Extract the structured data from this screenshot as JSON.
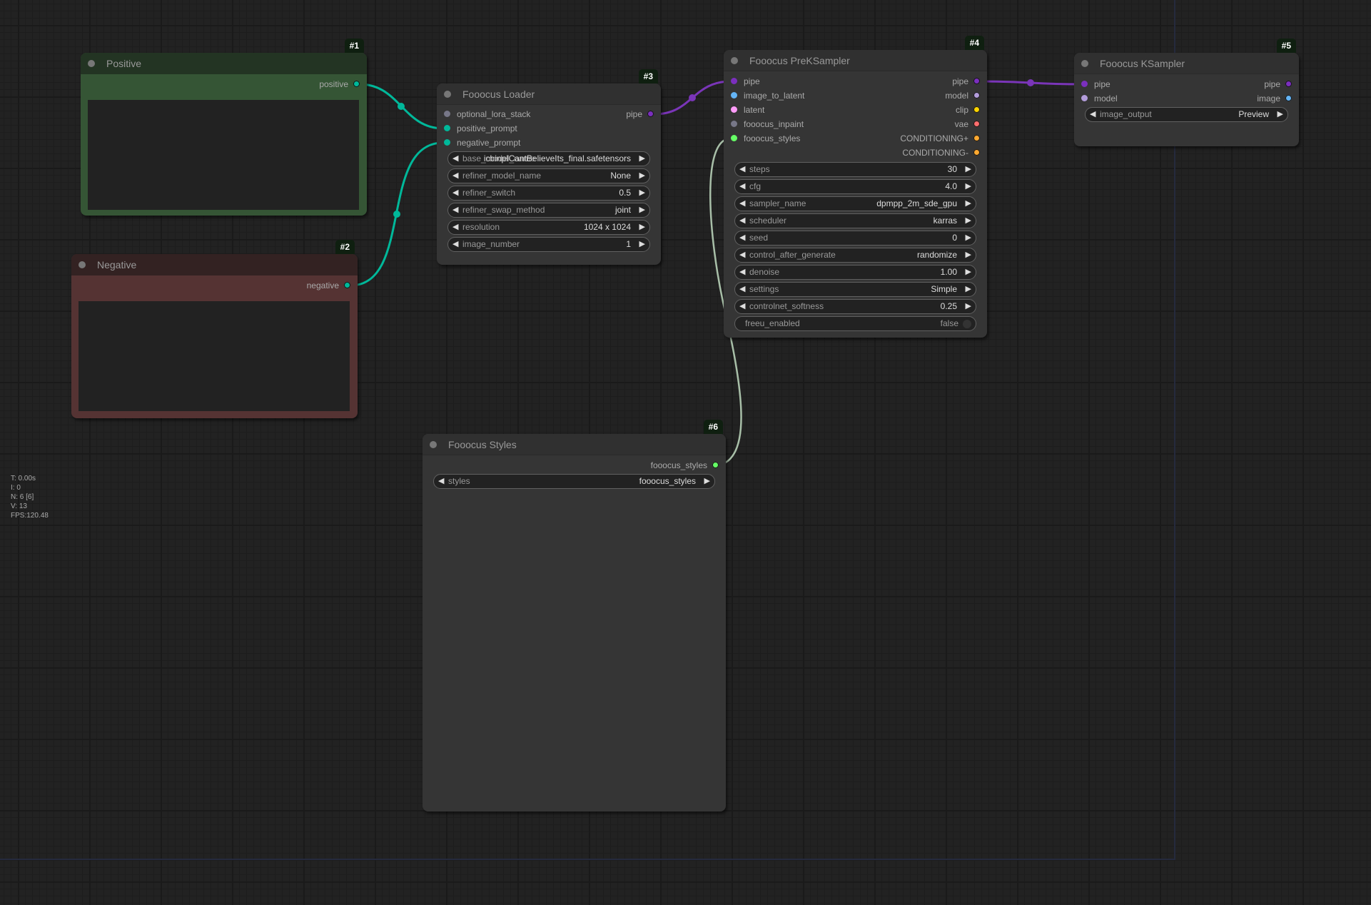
{
  "canvas": {
    "stats": [
      "T: 0.00s",
      "I: 0",
      "N: 6 [6]",
      "V: 13",
      "FPS:120.48"
    ]
  },
  "colors": {
    "canvas_bg": "#222222",
    "node_bg": "#353535",
    "node_title_bg": "#303030",
    "positive_title": "#233423",
    "positive_body": "#355535",
    "negative_title": "#332222",
    "negative_body": "#553333",
    "link_conditioning": "#00b89a",
    "link_pipe": "#7a35b8",
    "link_styles": "#a8bfa8",
    "pin_pipe": "#7b2fbe",
    "pin_image": "#64b5f6",
    "pin_latent": "#ff9cf9",
    "pin_grey": "#777788",
    "pin_styles": "#66ff66",
    "pin_model": "#b39ddb",
    "pin_clip": "#ffd500",
    "pin_vae": "#ff6e6e",
    "pin_conditioning": "#ffa931"
  },
  "nodes": {
    "positive": {
      "id": "#1",
      "title": "Positive",
      "outputs": [
        "positive"
      ],
      "text": ""
    },
    "negative": {
      "id": "#2",
      "title": "Negative",
      "outputs": [
        "negative"
      ],
      "text": ""
    },
    "loader": {
      "id": "#3",
      "title": "Fooocus Loader",
      "inputs": [
        "optional_lora_stack",
        "positive_prompt",
        "negative_prompt"
      ],
      "outputs": [
        "pipe"
      ],
      "widgets": [
        {
          "label": "base_model_name",
          "value": "icbinpICantBelieveIts_final.safetensors"
        },
        {
          "label": "refiner_model_name",
          "value": "None"
        },
        {
          "label": "refiner_switch",
          "value": "0.5"
        },
        {
          "label": "refiner_swap_method",
          "value": "joint"
        },
        {
          "label": "resolution",
          "value": "1024 x 1024"
        },
        {
          "label": "image_number",
          "value": "1"
        }
      ]
    },
    "prek": {
      "id": "#4",
      "title": "Fooocus PreKSampler",
      "inputs": [
        "pipe",
        "image_to_latent",
        "latent",
        "fooocus_inpaint",
        "fooocus_styles"
      ],
      "outputs": [
        "pipe",
        "model",
        "clip",
        "vae",
        "CONDITIONING+",
        "CONDITIONING-"
      ],
      "widgets": [
        {
          "label": "steps",
          "value": "30"
        },
        {
          "label": "cfg",
          "value": "4.0"
        },
        {
          "label": "sampler_name",
          "value": "dpmpp_2m_sde_gpu"
        },
        {
          "label": "scheduler",
          "value": "karras"
        },
        {
          "label": "seed",
          "value": "0"
        },
        {
          "label": "control_after_generate",
          "value": "randomize"
        },
        {
          "label": "denoise",
          "value": "1.00"
        },
        {
          "label": "settings",
          "value": "Simple"
        },
        {
          "label": "controlnet_softness",
          "value": "0.25"
        }
      ],
      "toggle": {
        "label": "freeu_enabled",
        "value": "false"
      }
    },
    "ksampler": {
      "id": "#5",
      "title": "Fooocus KSampler",
      "inputs": [
        "pipe",
        "model"
      ],
      "outputs": [
        "pipe",
        "image"
      ],
      "widgets": [
        {
          "label": "image_output",
          "value": "Preview"
        }
      ]
    },
    "styles": {
      "id": "#6",
      "title": "Fooocus Styles",
      "outputs": [
        "fooocus_styles"
      ],
      "widgets": [
        {
          "label": "styles",
          "value": "fooocus_styles"
        }
      ]
    }
  },
  "icons": {
    "arrow_left": "◀",
    "arrow_right": "▶"
  }
}
